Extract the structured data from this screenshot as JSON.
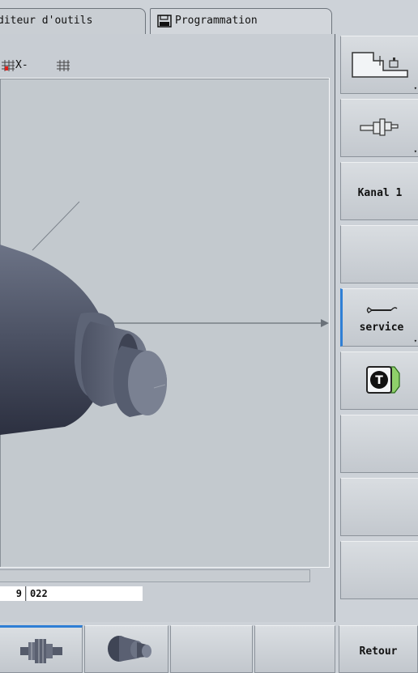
{
  "tabs": [
    {
      "label": "diteur d'outils",
      "icon": "tool-table-icon"
    },
    {
      "label": "Programmation",
      "icon": "floppy-disk-icon"
    }
  ],
  "toolbar": {
    "zoom_label": "X-"
  },
  "status": {
    "field1": "9",
    "field2": "022"
  },
  "softkeys_right": [
    {
      "label": "",
      "icon": "machine-tool-icon"
    },
    {
      "label": "",
      "icon": "spindle-icon"
    },
    {
      "label": "Kanal 1"
    },
    {
      "label": ""
    },
    {
      "label": "service",
      "icon": "wrench-icon"
    },
    {
      "label": "",
      "icon": "tool-t-icon"
    },
    {
      "label": ""
    },
    {
      "label": ""
    },
    {
      "label": ""
    }
  ],
  "softkeys_bottom": [
    {
      "label": "",
      "icon": "part-profile-icon"
    },
    {
      "label": "",
      "icon": "part-3d-icon"
    },
    {
      "label": ""
    },
    {
      "label": ""
    },
    {
      "label": "Retour"
    }
  ],
  "colors": {
    "accent": "#2f7fd5",
    "part": "#5a6172",
    "background": "#cdd2d8"
  }
}
